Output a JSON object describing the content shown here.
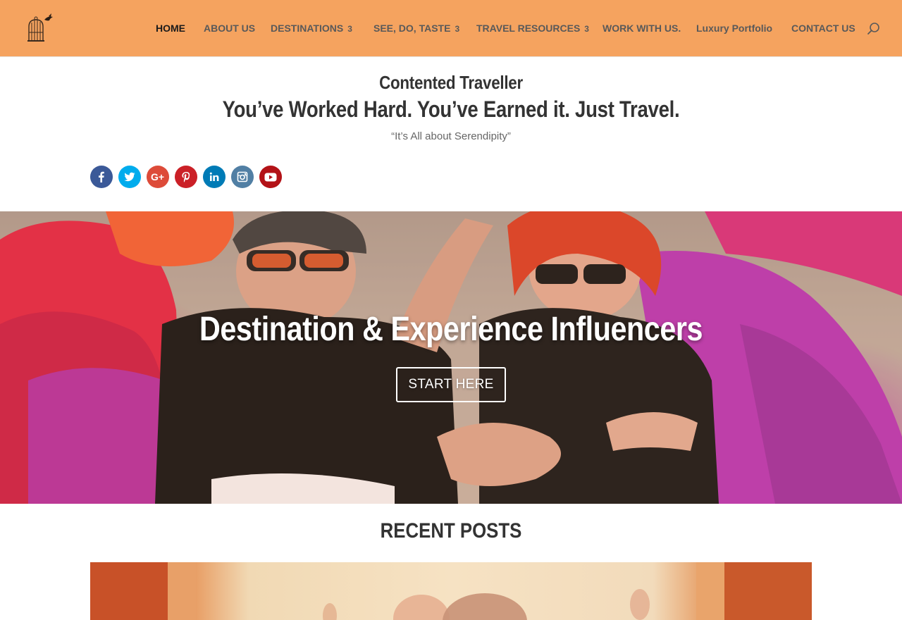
{
  "header": {
    "background": "#f5a35f",
    "logo_icon": "birdcage-logo-icon",
    "nav": [
      {
        "label": "HOME",
        "active": true,
        "has_dropdown": false,
        "dropdown_count": ""
      },
      {
        "label": "ABOUT US",
        "active": false,
        "has_dropdown": false,
        "dropdown_count": ""
      },
      {
        "label": "DESTINATIONS",
        "active": false,
        "has_dropdown": true,
        "dropdown_count": "3"
      },
      {
        "label": "SEE, DO, TASTE",
        "active": false,
        "has_dropdown": true,
        "dropdown_count": "3"
      },
      {
        "label": "TRAVEL RESOURCES",
        "active": false,
        "has_dropdown": true,
        "dropdown_count": "3"
      },
      {
        "label": "WORK WITH US.",
        "active": false,
        "has_dropdown": false,
        "dropdown_count": ""
      },
      {
        "label": "Luxury Portfolio",
        "active": false,
        "has_dropdown": false,
        "dropdown_count": ""
      },
      {
        "label": "CONTACT US",
        "active": false,
        "has_dropdown": false,
        "dropdown_count": ""
      }
    ],
    "search_icon": "search-icon"
  },
  "intro": {
    "site_title": "Contented Traveller",
    "tagline": "You’ve Worked Hard. You’ve Earned it. Just Travel.",
    "quote": "“It’s All about Serendipity”"
  },
  "social": [
    {
      "name": "facebook-icon",
      "color": "#3b5998"
    },
    {
      "name": "twitter-icon",
      "color": "#00aced"
    },
    {
      "name": "google-plus-icon",
      "color": "#dd4b39"
    },
    {
      "name": "pinterest-icon",
      "color": "#cb2027"
    },
    {
      "name": "linkedin-icon",
      "color": "#007bb6"
    },
    {
      "name": "instagram-icon",
      "color": "#517fa4"
    },
    {
      "name": "youtube-icon",
      "color": "#b31217"
    }
  ],
  "hero": {
    "heading": "Destination & Experience Influencers",
    "button_label": "START HERE"
  },
  "recent_posts": {
    "heading": "RECENT POSTS"
  }
}
